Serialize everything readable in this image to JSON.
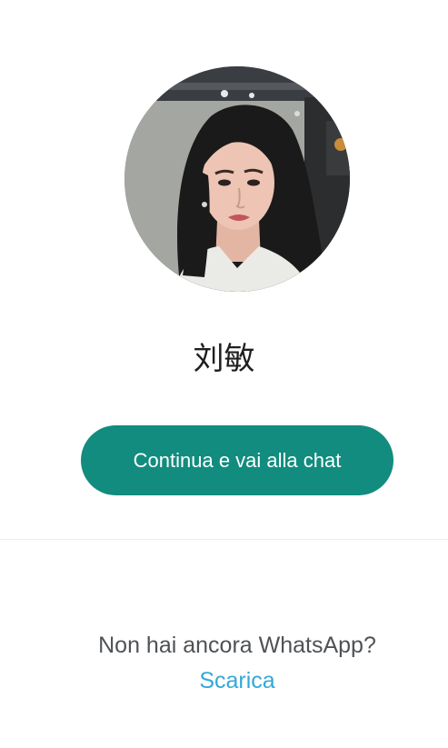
{
  "profile": {
    "avatar_alt": "profile-photo",
    "name": "刘敏"
  },
  "actions": {
    "continue_label": "Continua e vai alla chat"
  },
  "footer": {
    "prompt": "Non hai ancora WhatsApp?",
    "download_label": "Scarica"
  },
  "colors": {
    "accent": "#128c7e",
    "link": "#32a9d8",
    "text": "#1f1f1f",
    "muted": "#4f5256"
  }
}
